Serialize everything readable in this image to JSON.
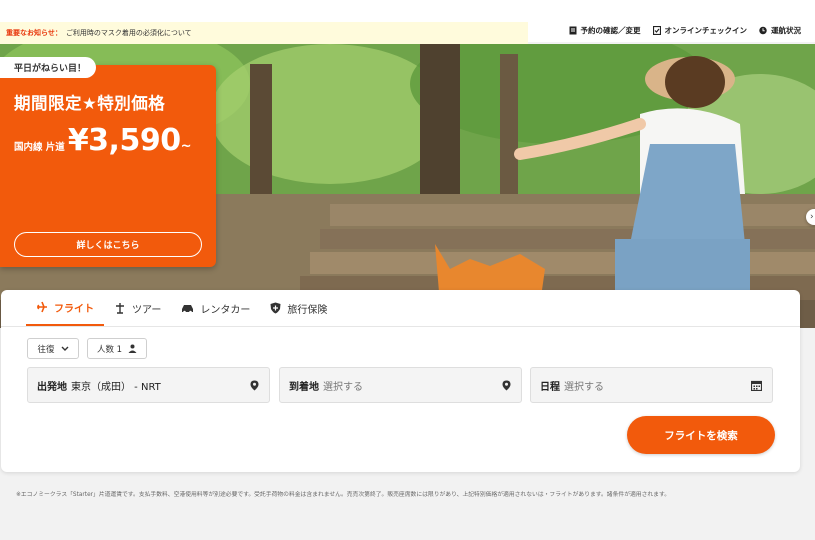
{
  "notice": {
    "label": "重要なお知らせ：",
    "text": "ご利用時のマスク着用の必須化について"
  },
  "utility": [
    {
      "icon": "document-icon",
      "label": "予約の確認／変更"
    },
    {
      "icon": "checkin-icon",
      "label": "オンラインチェックイン"
    },
    {
      "icon": "clock-icon",
      "label": "運航状況"
    }
  ],
  "promo": {
    "badge": "平日がねらい目！",
    "title": "期間限定★特別価格",
    "route": "国内線 片道",
    "price": "¥3,590",
    "tilde": "~",
    "button": "詳しくはこちら"
  },
  "carousel": {
    "slides": 3,
    "active": 1
  },
  "tabs": [
    {
      "icon": "airplane-icon",
      "label": "フライト",
      "active": true
    },
    {
      "icon": "tour-icon",
      "label": "ツアー",
      "active": false
    },
    {
      "icon": "car-icon",
      "label": "レンタカー",
      "active": false
    },
    {
      "icon": "shield-icon",
      "label": "旅行保険",
      "active": false
    }
  ],
  "search": {
    "trip_type": "往復",
    "passengers": "人数 1",
    "origin_label": "出発地",
    "origin_value": "東京（成田） - NRT",
    "destination_label": "到着地",
    "destination_placeholder": "選択する",
    "date_label": "日程",
    "date_placeholder": "選択する",
    "button": "フライトを検索"
  },
  "footnote": "※エコノミークラス「Starter」片道運賃です。支払手数料、空港使用料等が別途必要です。受託手荷物の料金は含まれません。売売次第終了。販売座席数には限りがあり、上記特別価格が適用されないは・フライトがあります。諸条件が適用されます。",
  "colors": {
    "brand": "#f25a0c",
    "notice_bg": "#fffbdc",
    "notice_label": "#e8380d"
  }
}
